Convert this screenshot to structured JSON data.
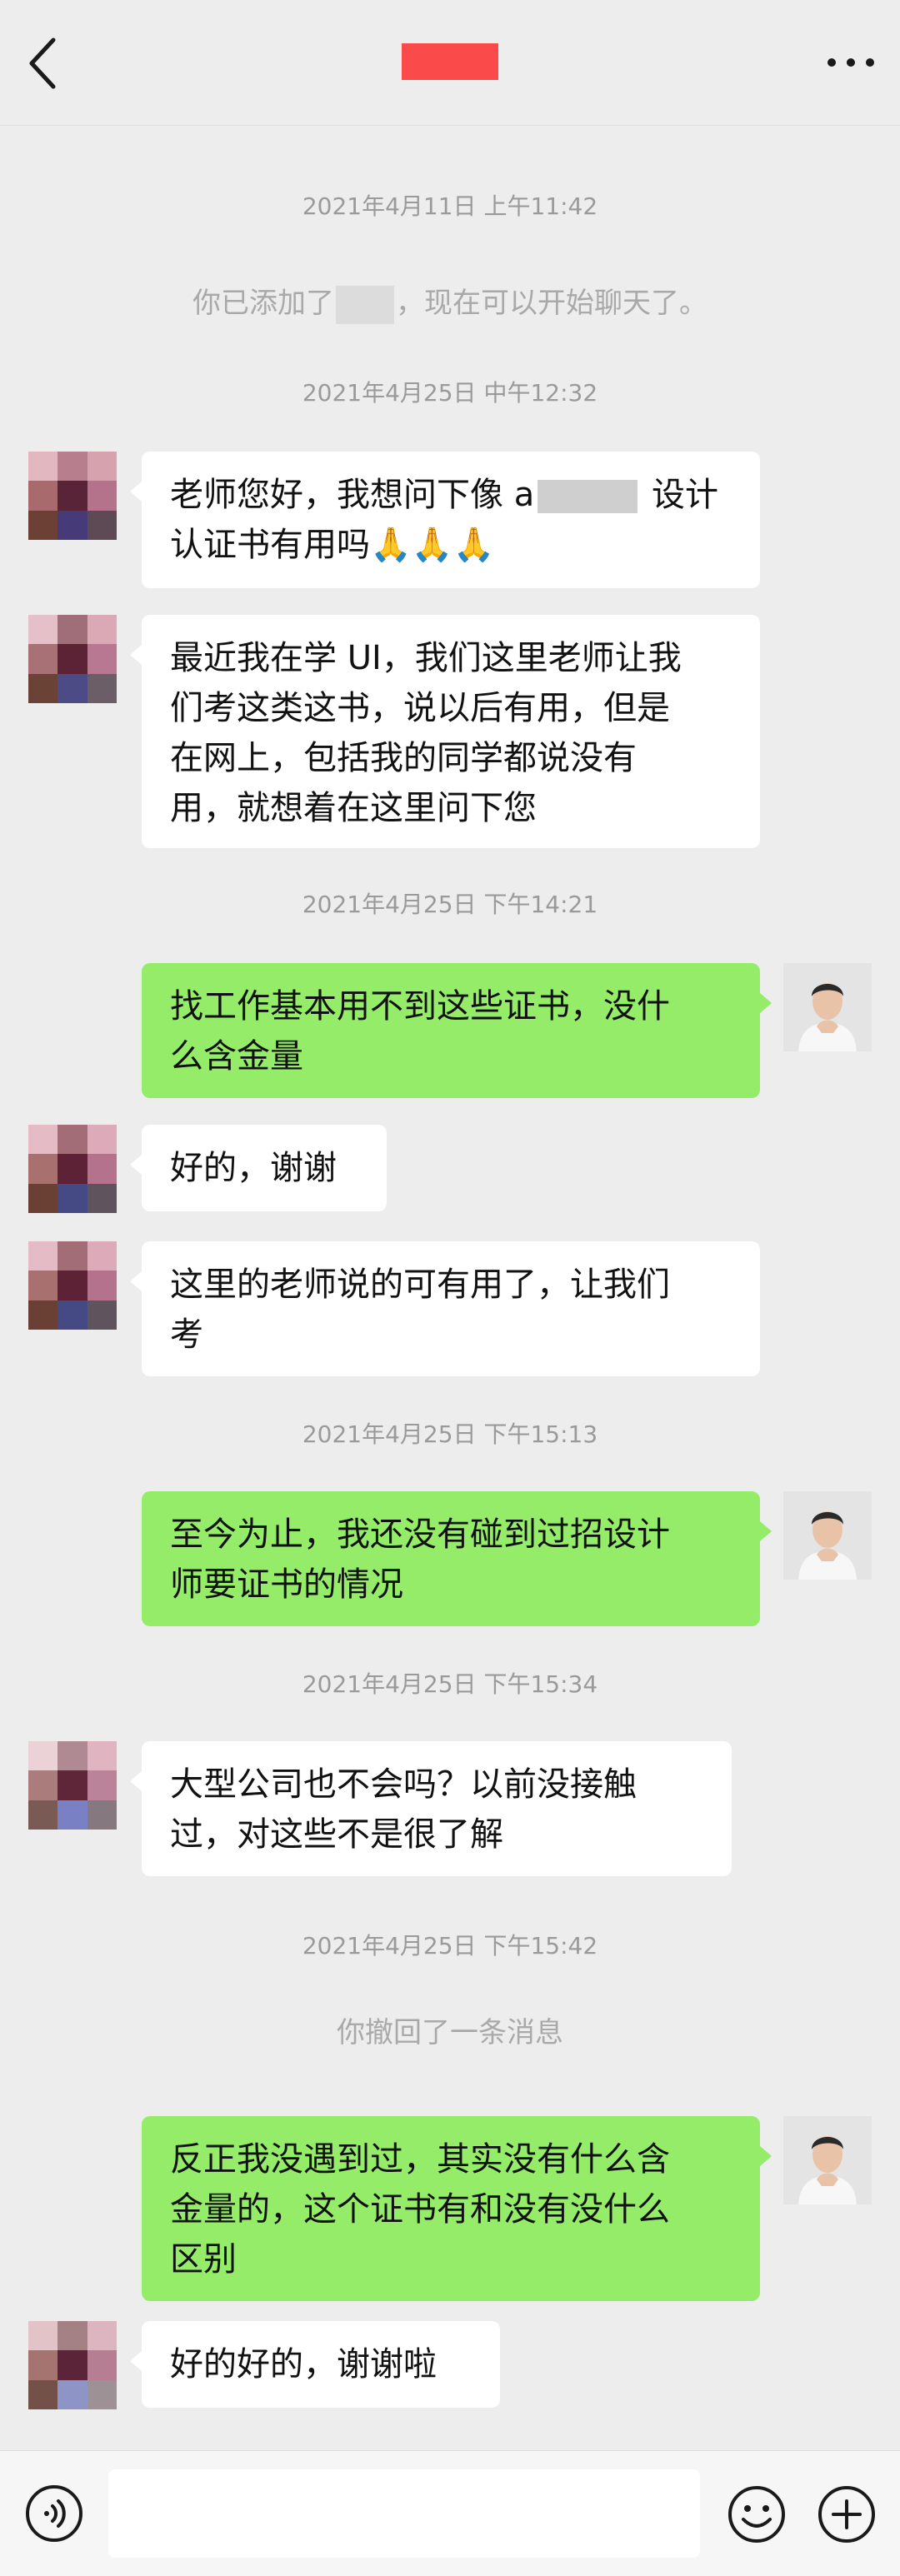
{
  "header": {
    "title_color": "#fb4a4a",
    "back_icon": "chevron-left-icon",
    "more_icon": "more-dots-icon"
  },
  "messages": {
    "t1": "2021年4月11日 上午11:42",
    "sys_added_prefix": "你已添加了",
    "sys_added_suffix": "，现在可以开始聊天了。",
    "t2": "2021年4月25日 中午12:32",
    "m1_a": "老师您好，我想问下像 a",
    "m1_b": " 设计\n认证书有用吗🙏🙏🙏",
    "m2": "最近我在学 UI，我们这里老师让我\n们考这类这书，说以后有用，但是\n在网上，包括我的同学都说没有\n用，就想着在这里问下您",
    "t3": "2021年4月25日 下午14:21",
    "m3": "找工作基本用不到这些证书，没什\n么含金量",
    "m4": "好的，谢谢",
    "m5": "这里的老师说的可有用了，让我们\n考",
    "t4": "2021年4月25日 下午15:13",
    "m6": "至今为止，我还没有碰到过招设计\n师要证书的情况",
    "t5": "2021年4月25日 下午15:34",
    "m7": "大型公司也不会吗？以前没接触\n过，对这些不是很了解",
    "t6": "2021年4月25日 下午15:42",
    "sys_recall": "你撤回了一条消息",
    "m8": "反正我没遇到过，其实没有什么含\n金量的，这个证书有和没有没什么\n区别",
    "m9": "好的好的，谢谢啦"
  },
  "input": {
    "placeholder": ""
  },
  "colors": {
    "outgoing_bubble": "#95ec69",
    "incoming_bubble": "#ffffff",
    "background": "#ededed"
  },
  "icons": [
    "voice-icon",
    "emoji-icon",
    "plus-icon"
  ]
}
